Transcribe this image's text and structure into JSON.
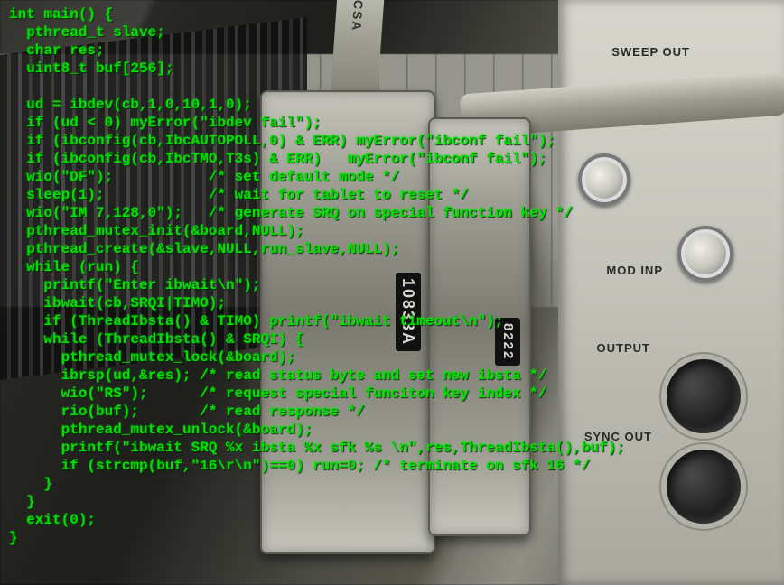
{
  "code": {
    "lines": [
      "int main() {",
      "  pthread_t slave;",
      "  char res;",
      "  uint8_t buf[256];",
      "",
      "  ud = ibdev(cb,1,0,10,1,0);",
      "  if (ud < 0) myError(\"ibdev fail\");",
      "  if (ibconfig(cb,IbcAUTOPOLL,0) & ERR) myError(\"ibconf fail\");",
      "  if (ibconfig(cb,IbcTMO,T3s) & ERR)   myError(\"ibconf fail\");",
      "  wio(\"DF\");           /* set default mode */",
      "  sleep(1);            /* wait for tablet to reset */",
      "  wio(\"IM 7,128,0\");   /* generate SRQ on special function key */",
      "  pthread_mutex_init(&board,NULL);",
      "  pthread_create(&slave,NULL,run_slave,NULL);",
      "  while (run) {",
      "    printf(\"Enter ibwait\\n\");",
      "    ibwait(cb,SRQI|TIMO);",
      "    if (ThreadIbsta() & TIMO) printf(\"ibwait timeout\\n\");",
      "    while (ThreadIbsta() & SRQI) {",
      "      pthread_mutex_lock(&board);",
      "      ibrsp(ud,&res); /* read status byte and set new ibsta */",
      "      wio(\"RS\");      /* request special funciton key index */",
      "      rio(buf);       /* read response */",
      "      pthread_mutex_unlock(&board);",
      "      printf(\"ibwait SRQ %x ibsta %x sfk %s \\n\",res,ThreadIbsta(),buf);",
      "      if (strcmp(buf,\"16\\r\\n\")==0) run=0; /* terminate on sfk 16 */",
      "    }",
      "  }",
      "  exit(0);",
      "}"
    ]
  },
  "hardware": {
    "cable_marking": "CSA",
    "connector1_pn": "10833A",
    "connector2_pn": "8222",
    "panel": {
      "label_sweep_out": "SWEEP OUT",
      "label_mod_inp": "MOD INP",
      "label_output": "OUTPUT",
      "label_sync_out": "SYNC OUT"
    }
  }
}
